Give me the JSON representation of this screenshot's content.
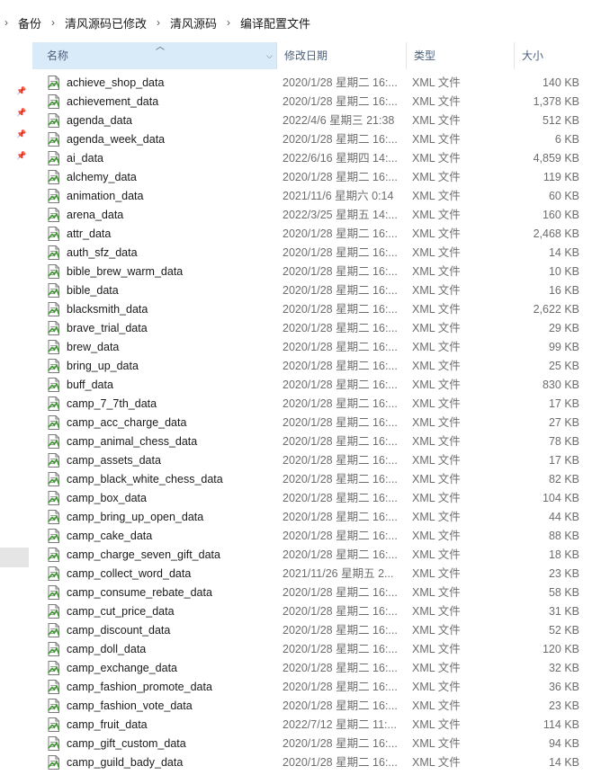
{
  "breadcrumb": [
    "备份",
    "清风源码已修改",
    "清风源码",
    "编译配置文件"
  ],
  "columns": {
    "name": "名称",
    "modified": "修改日期",
    "type": "类型",
    "size": "大小"
  },
  "files": [
    {
      "name": "achieve_shop_data",
      "modified": "2020/1/28 星期二 16:...",
      "type": "XML 文件",
      "size": "140 KB"
    },
    {
      "name": "achievement_data",
      "modified": "2020/1/28 星期二 16:...",
      "type": "XML 文件",
      "size": "1,378 KB"
    },
    {
      "name": "agenda_data",
      "modified": "2022/4/6 星期三 21:38",
      "type": "XML 文件",
      "size": "512 KB"
    },
    {
      "name": "agenda_week_data",
      "modified": "2020/1/28 星期二 16:...",
      "type": "XML 文件",
      "size": "6 KB"
    },
    {
      "name": "ai_data",
      "modified": "2022/6/16 星期四 14:...",
      "type": "XML 文件",
      "size": "4,859 KB"
    },
    {
      "name": "alchemy_data",
      "modified": "2020/1/28 星期二 16:...",
      "type": "XML 文件",
      "size": "119 KB"
    },
    {
      "name": "animation_data",
      "modified": "2021/11/6 星期六 0:14",
      "type": "XML 文件",
      "size": "60 KB"
    },
    {
      "name": "arena_data",
      "modified": "2022/3/25 星期五 14:...",
      "type": "XML 文件",
      "size": "160 KB"
    },
    {
      "name": "attr_data",
      "modified": "2020/1/28 星期二 16:...",
      "type": "XML 文件",
      "size": "2,468 KB"
    },
    {
      "name": "auth_sfz_data",
      "modified": "2020/1/28 星期二 16:...",
      "type": "XML 文件",
      "size": "14 KB"
    },
    {
      "name": "bible_brew_warm_data",
      "modified": "2020/1/28 星期二 16:...",
      "type": "XML 文件",
      "size": "10 KB"
    },
    {
      "name": "bible_data",
      "modified": "2020/1/28 星期二 16:...",
      "type": "XML 文件",
      "size": "16 KB"
    },
    {
      "name": "blacksmith_data",
      "modified": "2020/1/28 星期二 16:...",
      "type": "XML 文件",
      "size": "2,622 KB"
    },
    {
      "name": "brave_trial_data",
      "modified": "2020/1/28 星期二 16:...",
      "type": "XML 文件",
      "size": "29 KB"
    },
    {
      "name": "brew_data",
      "modified": "2020/1/28 星期二 16:...",
      "type": "XML 文件",
      "size": "99 KB"
    },
    {
      "name": "bring_up_data",
      "modified": "2020/1/28 星期二 16:...",
      "type": "XML 文件",
      "size": "25 KB"
    },
    {
      "name": "buff_data",
      "modified": "2020/1/28 星期二 16:...",
      "type": "XML 文件",
      "size": "830 KB"
    },
    {
      "name": "camp_7_7th_data",
      "modified": "2020/1/28 星期二 16:...",
      "type": "XML 文件",
      "size": "17 KB"
    },
    {
      "name": "camp_acc_charge_data",
      "modified": "2020/1/28 星期二 16:...",
      "type": "XML 文件",
      "size": "27 KB"
    },
    {
      "name": "camp_animal_chess_data",
      "modified": "2020/1/28 星期二 16:...",
      "type": "XML 文件",
      "size": "78 KB"
    },
    {
      "name": "camp_assets_data",
      "modified": "2020/1/28 星期二 16:...",
      "type": "XML 文件",
      "size": "17 KB"
    },
    {
      "name": "camp_black_white_chess_data",
      "modified": "2020/1/28 星期二 16:...",
      "type": "XML 文件",
      "size": "82 KB"
    },
    {
      "name": "camp_box_data",
      "modified": "2020/1/28 星期二 16:...",
      "type": "XML 文件",
      "size": "104 KB"
    },
    {
      "name": "camp_bring_up_open_data",
      "modified": "2020/1/28 星期二 16:...",
      "type": "XML 文件",
      "size": "44 KB"
    },
    {
      "name": "camp_cake_data",
      "modified": "2020/1/28 星期二 16:...",
      "type": "XML 文件",
      "size": "88 KB"
    },
    {
      "name": "camp_charge_seven_gift_data",
      "modified": "2020/1/28 星期二 16:...",
      "type": "XML 文件",
      "size": "18 KB"
    },
    {
      "name": "camp_collect_word_data",
      "modified": "2021/11/26 星期五 2...",
      "type": "XML 文件",
      "size": "23 KB"
    },
    {
      "name": "camp_consume_rebate_data",
      "modified": "2020/1/28 星期二 16:...",
      "type": "XML 文件",
      "size": "58 KB"
    },
    {
      "name": "camp_cut_price_data",
      "modified": "2020/1/28 星期二 16:...",
      "type": "XML 文件",
      "size": "31 KB"
    },
    {
      "name": "camp_discount_data",
      "modified": "2020/1/28 星期二 16:...",
      "type": "XML 文件",
      "size": "52 KB"
    },
    {
      "name": "camp_doll_data",
      "modified": "2020/1/28 星期二 16:...",
      "type": "XML 文件",
      "size": "120 KB"
    },
    {
      "name": "camp_exchange_data",
      "modified": "2020/1/28 星期二 16:...",
      "type": "XML 文件",
      "size": "32 KB"
    },
    {
      "name": "camp_fashion_promote_data",
      "modified": "2020/1/28 星期二 16:...",
      "type": "XML 文件",
      "size": "36 KB"
    },
    {
      "name": "camp_fashion_vote_data",
      "modified": "2020/1/28 星期二 16:...",
      "type": "XML 文件",
      "size": "23 KB"
    },
    {
      "name": "camp_fruit_data",
      "modified": "2022/7/12 星期二 11:...",
      "type": "XML 文件",
      "size": "114 KB"
    },
    {
      "name": "camp_gift_custom_data",
      "modified": "2020/1/28 星期二 16:...",
      "type": "XML 文件",
      "size": "94 KB"
    },
    {
      "name": "camp_guild_bady_data",
      "modified": "2020/1/28 星期二 16:...",
      "type": "XML 文件",
      "size": "14 KB"
    }
  ]
}
